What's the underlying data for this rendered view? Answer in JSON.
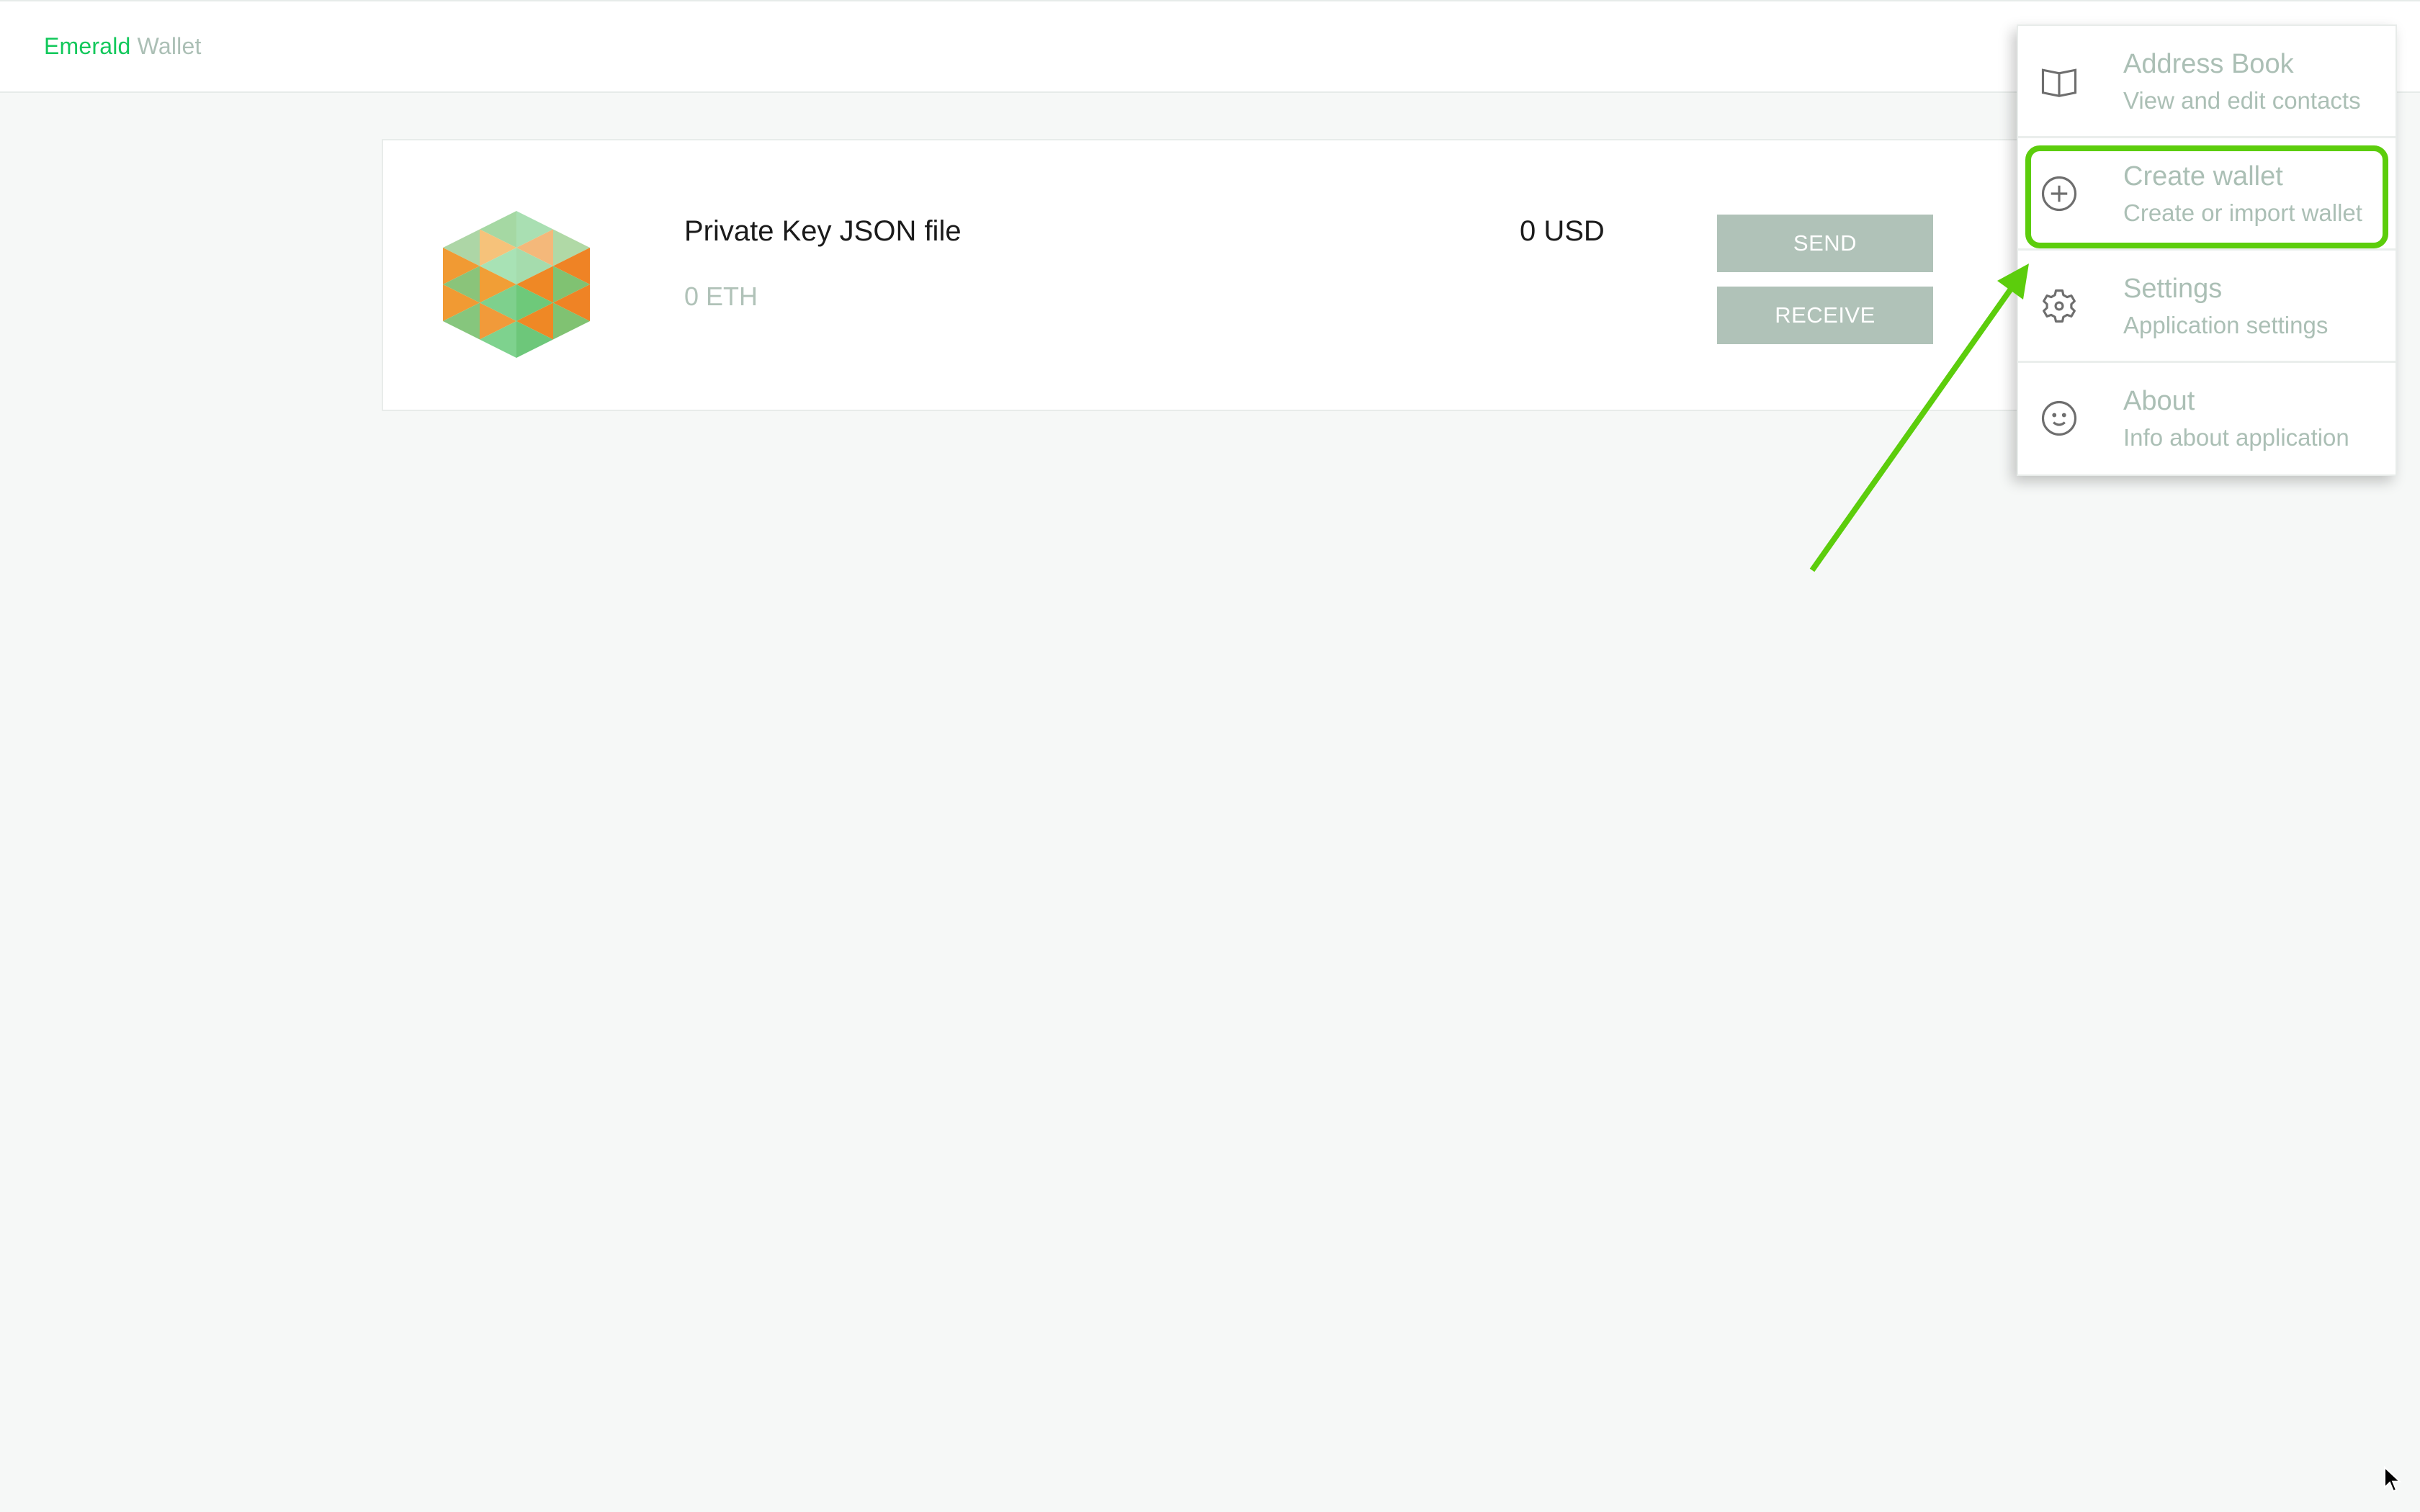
{
  "header": {
    "brand_primary": "Emerald",
    "brand_secondary": "Wallet"
  },
  "wallet": {
    "icon": "hexagon-identicon",
    "name": "Private Key JSON file",
    "balance_eth": "0 ETH",
    "balance_usd": "0 USD",
    "send_label": "SEND",
    "receive_label": "RECEIVE"
  },
  "menu": {
    "items": [
      {
        "icon": "book-icon",
        "title": "Address Book",
        "subtitle": "View and edit contacts"
      },
      {
        "icon": "plus-circle-icon",
        "title": "Create wallet",
        "subtitle": "Create or import wallet"
      },
      {
        "icon": "gear-icon",
        "title": "Settings",
        "subtitle": "Application settings"
      },
      {
        "icon": "smiley-icon",
        "title": "About",
        "subtitle": "Info about application"
      }
    ],
    "highlighted_item": "Create wallet"
  },
  "colors": {
    "brand_green": "#12c85b",
    "muted_text": "#abbfb5",
    "button_bg": "#b0c2b8",
    "annotation_green": "#5ccd0c",
    "background": "#f6f8f7"
  }
}
